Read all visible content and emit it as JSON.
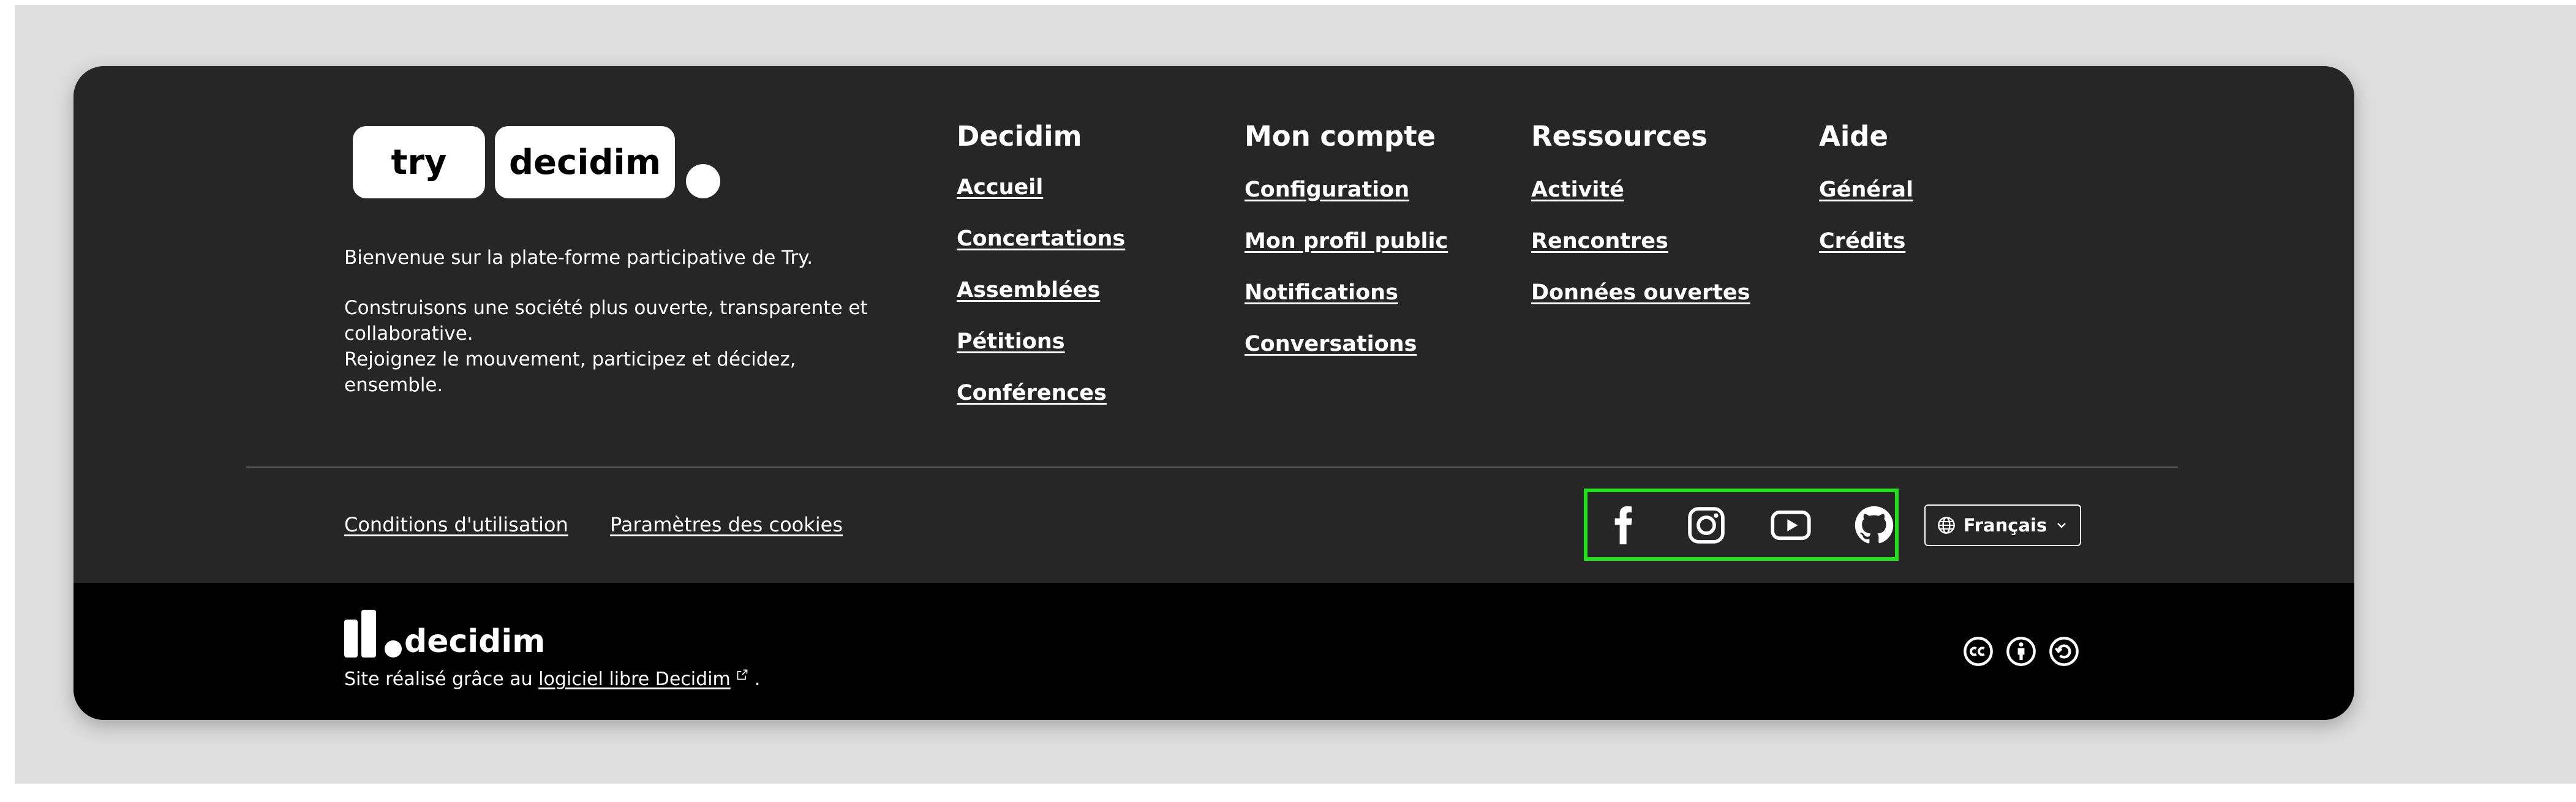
{
  "logo": {
    "part1": "try",
    "part2": "decidim"
  },
  "description": {
    "line1": "Bienvenue sur la plate-forme participative de Try.",
    "line2": "Construisons une société plus ouverte, transparente et collaborative.",
    "line3": "Rejoignez le mouvement, participez et décidez, ensemble."
  },
  "columns": [
    {
      "title": "Decidim",
      "links": [
        "Accueil",
        "Concertations",
        "Assemblées",
        "Pétitions",
        "Conférences"
      ]
    },
    {
      "title": "Mon compte",
      "links": [
        "Configuration",
        "Mon profil public",
        "Notifications",
        "Conversations"
      ]
    },
    {
      "title": "Ressources",
      "links": [
        "Activité",
        "Rencontres",
        "Données ouvertes"
      ]
    },
    {
      "title": "Aide",
      "links": [
        "Général",
        "Crédits"
      ]
    }
  ],
  "legal": {
    "terms": "Conditions d'utilisation",
    "cookies": "Paramètres des cookies"
  },
  "social": [
    "facebook-icon",
    "instagram-icon",
    "youtube-icon",
    "github-icon"
  ],
  "language": {
    "label": "Français"
  },
  "bottom": {
    "brand": "decidim",
    "made_with_prefix": "Site réalisé grâce au",
    "made_with_link": "logiciel libre Decidim",
    "made_with_suffix": "."
  },
  "colors": {
    "footer": "#262626",
    "bottom_bar": "#000000",
    "highlight": "#22e01b",
    "text": "#ffffff"
  }
}
